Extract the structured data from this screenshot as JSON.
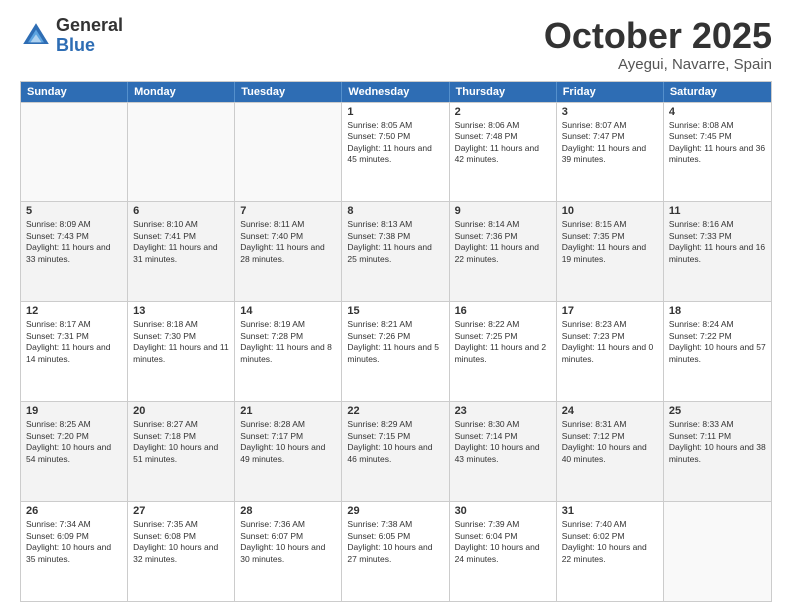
{
  "logo": {
    "general": "General",
    "blue": "Blue"
  },
  "header": {
    "month": "October 2025",
    "location": "Ayegui, Navarre, Spain"
  },
  "weekdays": [
    "Sunday",
    "Monday",
    "Tuesday",
    "Wednesday",
    "Thursday",
    "Friday",
    "Saturday"
  ],
  "rows": [
    [
      {
        "day": "",
        "sunrise": "",
        "sunset": "",
        "daylight": ""
      },
      {
        "day": "",
        "sunrise": "",
        "sunset": "",
        "daylight": ""
      },
      {
        "day": "",
        "sunrise": "",
        "sunset": "",
        "daylight": ""
      },
      {
        "day": "1",
        "sunrise": "Sunrise: 8:05 AM",
        "sunset": "Sunset: 7:50 PM",
        "daylight": "Daylight: 11 hours and 45 minutes."
      },
      {
        "day": "2",
        "sunrise": "Sunrise: 8:06 AM",
        "sunset": "Sunset: 7:48 PM",
        "daylight": "Daylight: 11 hours and 42 minutes."
      },
      {
        "day": "3",
        "sunrise": "Sunrise: 8:07 AM",
        "sunset": "Sunset: 7:47 PM",
        "daylight": "Daylight: 11 hours and 39 minutes."
      },
      {
        "day": "4",
        "sunrise": "Sunrise: 8:08 AM",
        "sunset": "Sunset: 7:45 PM",
        "daylight": "Daylight: 11 hours and 36 minutes."
      }
    ],
    [
      {
        "day": "5",
        "sunrise": "Sunrise: 8:09 AM",
        "sunset": "Sunset: 7:43 PM",
        "daylight": "Daylight: 11 hours and 33 minutes."
      },
      {
        "day": "6",
        "sunrise": "Sunrise: 8:10 AM",
        "sunset": "Sunset: 7:41 PM",
        "daylight": "Daylight: 11 hours and 31 minutes."
      },
      {
        "day": "7",
        "sunrise": "Sunrise: 8:11 AM",
        "sunset": "Sunset: 7:40 PM",
        "daylight": "Daylight: 11 hours and 28 minutes."
      },
      {
        "day": "8",
        "sunrise": "Sunrise: 8:13 AM",
        "sunset": "Sunset: 7:38 PM",
        "daylight": "Daylight: 11 hours and 25 minutes."
      },
      {
        "day": "9",
        "sunrise": "Sunrise: 8:14 AM",
        "sunset": "Sunset: 7:36 PM",
        "daylight": "Daylight: 11 hours and 22 minutes."
      },
      {
        "day": "10",
        "sunrise": "Sunrise: 8:15 AM",
        "sunset": "Sunset: 7:35 PM",
        "daylight": "Daylight: 11 hours and 19 minutes."
      },
      {
        "day": "11",
        "sunrise": "Sunrise: 8:16 AM",
        "sunset": "Sunset: 7:33 PM",
        "daylight": "Daylight: 11 hours and 16 minutes."
      }
    ],
    [
      {
        "day": "12",
        "sunrise": "Sunrise: 8:17 AM",
        "sunset": "Sunset: 7:31 PM",
        "daylight": "Daylight: 11 hours and 14 minutes."
      },
      {
        "day": "13",
        "sunrise": "Sunrise: 8:18 AM",
        "sunset": "Sunset: 7:30 PM",
        "daylight": "Daylight: 11 hours and 11 minutes."
      },
      {
        "day": "14",
        "sunrise": "Sunrise: 8:19 AM",
        "sunset": "Sunset: 7:28 PM",
        "daylight": "Daylight: 11 hours and 8 minutes."
      },
      {
        "day": "15",
        "sunrise": "Sunrise: 8:21 AM",
        "sunset": "Sunset: 7:26 PM",
        "daylight": "Daylight: 11 hours and 5 minutes."
      },
      {
        "day": "16",
        "sunrise": "Sunrise: 8:22 AM",
        "sunset": "Sunset: 7:25 PM",
        "daylight": "Daylight: 11 hours and 2 minutes."
      },
      {
        "day": "17",
        "sunrise": "Sunrise: 8:23 AM",
        "sunset": "Sunset: 7:23 PM",
        "daylight": "Daylight: 11 hours and 0 minutes."
      },
      {
        "day": "18",
        "sunrise": "Sunrise: 8:24 AM",
        "sunset": "Sunset: 7:22 PM",
        "daylight": "Daylight: 10 hours and 57 minutes."
      }
    ],
    [
      {
        "day": "19",
        "sunrise": "Sunrise: 8:25 AM",
        "sunset": "Sunset: 7:20 PM",
        "daylight": "Daylight: 10 hours and 54 minutes."
      },
      {
        "day": "20",
        "sunrise": "Sunrise: 8:27 AM",
        "sunset": "Sunset: 7:18 PM",
        "daylight": "Daylight: 10 hours and 51 minutes."
      },
      {
        "day": "21",
        "sunrise": "Sunrise: 8:28 AM",
        "sunset": "Sunset: 7:17 PM",
        "daylight": "Daylight: 10 hours and 49 minutes."
      },
      {
        "day": "22",
        "sunrise": "Sunrise: 8:29 AM",
        "sunset": "Sunset: 7:15 PM",
        "daylight": "Daylight: 10 hours and 46 minutes."
      },
      {
        "day": "23",
        "sunrise": "Sunrise: 8:30 AM",
        "sunset": "Sunset: 7:14 PM",
        "daylight": "Daylight: 10 hours and 43 minutes."
      },
      {
        "day": "24",
        "sunrise": "Sunrise: 8:31 AM",
        "sunset": "Sunset: 7:12 PM",
        "daylight": "Daylight: 10 hours and 40 minutes."
      },
      {
        "day": "25",
        "sunrise": "Sunrise: 8:33 AM",
        "sunset": "Sunset: 7:11 PM",
        "daylight": "Daylight: 10 hours and 38 minutes."
      }
    ],
    [
      {
        "day": "26",
        "sunrise": "Sunrise: 7:34 AM",
        "sunset": "Sunset: 6:09 PM",
        "daylight": "Daylight: 10 hours and 35 minutes."
      },
      {
        "day": "27",
        "sunrise": "Sunrise: 7:35 AM",
        "sunset": "Sunset: 6:08 PM",
        "daylight": "Daylight: 10 hours and 32 minutes."
      },
      {
        "day": "28",
        "sunrise": "Sunrise: 7:36 AM",
        "sunset": "Sunset: 6:07 PM",
        "daylight": "Daylight: 10 hours and 30 minutes."
      },
      {
        "day": "29",
        "sunrise": "Sunrise: 7:38 AM",
        "sunset": "Sunset: 6:05 PM",
        "daylight": "Daylight: 10 hours and 27 minutes."
      },
      {
        "day": "30",
        "sunrise": "Sunrise: 7:39 AM",
        "sunset": "Sunset: 6:04 PM",
        "daylight": "Daylight: 10 hours and 24 minutes."
      },
      {
        "day": "31",
        "sunrise": "Sunrise: 7:40 AM",
        "sunset": "Sunset: 6:02 PM",
        "daylight": "Daylight: 10 hours and 22 minutes."
      },
      {
        "day": "",
        "sunrise": "",
        "sunset": "",
        "daylight": ""
      }
    ]
  ]
}
